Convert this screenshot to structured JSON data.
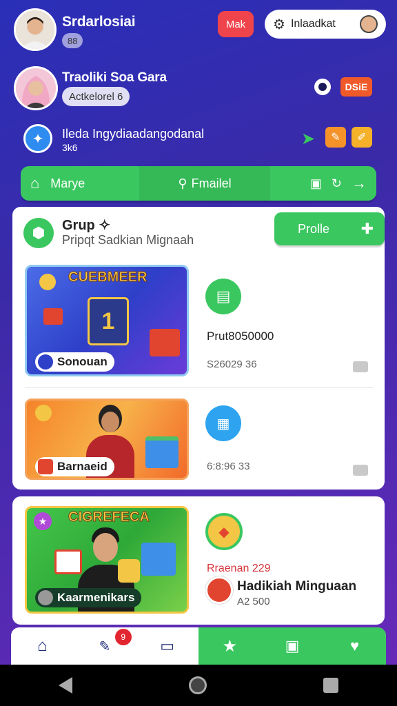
{
  "header": {
    "user1_name": "Srdarlosiai",
    "user1_badge": "88",
    "btn_red_label": "Mak",
    "btn_white_label": "Inlaadkat"
  },
  "user2": {
    "name": "Traoliki Soa Gara",
    "badge": "Actkelorel 6",
    "tag_label": "DSiE"
  },
  "user3": {
    "line1": "Ileda Ingydiaadangodanal",
    "line2": "3k6"
  },
  "navbar": {
    "home_label": "Marye",
    "search_label": "Fmailel"
  },
  "group": {
    "title": "Grup",
    "subtitle": "Pripqt Sadkian Mignaah",
    "profile_button": "Prolle"
  },
  "promos": [
    {
      "banner": "CUEBMEER",
      "tag": "Sonouan",
      "amount": "Prut8050000",
      "sub": "S26029 36"
    },
    {
      "banner": "",
      "tag": "Barnaeid",
      "amount": "",
      "sub": "6:8:96 33"
    },
    {
      "banner": "CIGREFECA",
      "tag": "Kaarmenikars",
      "red_text": "Rraenan 229",
      "title": "Hadikiah Minguaan",
      "sub": "A2 500"
    }
  ],
  "bottom_nav": {
    "notif_count": "9"
  },
  "colors": {
    "accent_green": "#3bc760",
    "accent_red": "#f0444c",
    "bg_blue": "#2a2fb8"
  }
}
